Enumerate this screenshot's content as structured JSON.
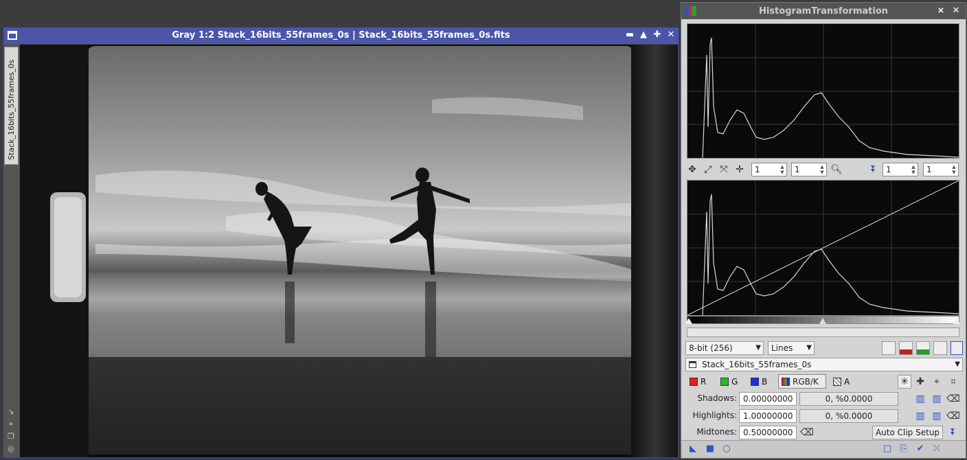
{
  "image_window": {
    "title": "Gray 1:2 Stack_16bits_55frames_0s | Stack_16bits_55frames_0s.fits",
    "side_tab": "Stack_16bits_55frames_0s",
    "buttons": {
      "shade": "▬",
      "minimize": "▲",
      "maximize": "✚",
      "close": "✕"
    }
  },
  "histogram_panel": {
    "title": "HistogramTransformation",
    "zoom_row1": {
      "h": "1",
      "v": "1"
    },
    "zoom_row2": {
      "h": "1",
      "v": "1"
    },
    "resolution": "8-bit (256)",
    "graph_style": "Lines",
    "view_selector": "Stack_16bits_55frames_0s",
    "channels": {
      "r": {
        "label": "R",
        "color": "#e02020"
      },
      "g": {
        "label": "G",
        "color": "#20c020"
      },
      "b": {
        "label": "B",
        "color": "#2030e0"
      },
      "rgbk": {
        "label": "RGB/K"
      },
      "a": {
        "label": "A"
      }
    },
    "shadows": {
      "label": "Shadows:",
      "value": "0.00000000",
      "clip": "0, %0.0000"
    },
    "highlights": {
      "label": "Highlights:",
      "value": "1.00000000",
      "clip": "0, %0.0000"
    },
    "midtones": {
      "label": "Midtones:",
      "value": "0.50000000"
    },
    "auto_clip_label": "Auto Clip Setup"
  }
}
